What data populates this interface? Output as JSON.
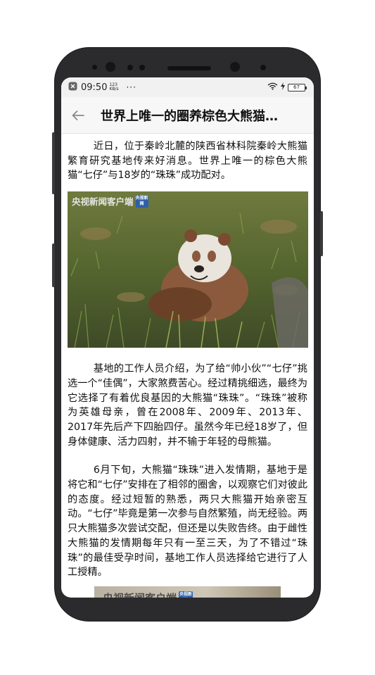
{
  "status_bar": {
    "time": "09:50",
    "network_speed": "123 KB/s",
    "more": "···",
    "battery": "67"
  },
  "header": {
    "title": "世界上唯一的圈养棕色大熊猫…"
  },
  "article": {
    "paragraphs": [
      "近日，位于秦岭北麓的陕西省林科院秦岭大熊猫繁育研究基地传来好消息。世界上唯一的棕色大熊猫“七仔”与18岁的“珠珠”成功配对。",
      "基地的工作人员介绍，为了给“帅小伙”“七仔”挑选一个“佳偶”，大家煞费苦心。经过精挑细选，最终为它选择了有着优良基因的大熊猫“珠珠”。“珠珠”被称为英雄母亲，曾在2008年、2009年、2013年、2017年先后产下四胎四仔。虽然今年已经18岁了，但身体健康、活力四射，并不输于年轻的母熊猫。",
      "6月下旬，大熊猫“珠珠”进入发情期，基地于是将它和“七仔”安排在了相邻的圈舍，以观察它们对彼此的态度。经过短暂的熟悉，两只大熊猫开始亲密互动。“七仔”毕竟是第一次参与自然繁殖，尚无经验。两只大熊猫多次尝试交配，但还是以失败告终。由于雌性大熊猫的发情期每年只有一至三天，为了不错过“珠珠”的最佳受孕时间，基地工作人员选择给它进行了人工授精。"
    ],
    "image_watermark": "央视新闻客户端",
    "watermark_logo_text": "央视新闻"
  },
  "colors": {
    "phone_frame": "#2b2b2d",
    "status_bar_bg": "#f1f1f1",
    "title_bar_bg": "#f7f7f7"
  },
  "icons": [
    "back-arrow-icon",
    "wifi-icon",
    "charging-icon",
    "battery-icon",
    "notification-icon"
  ]
}
